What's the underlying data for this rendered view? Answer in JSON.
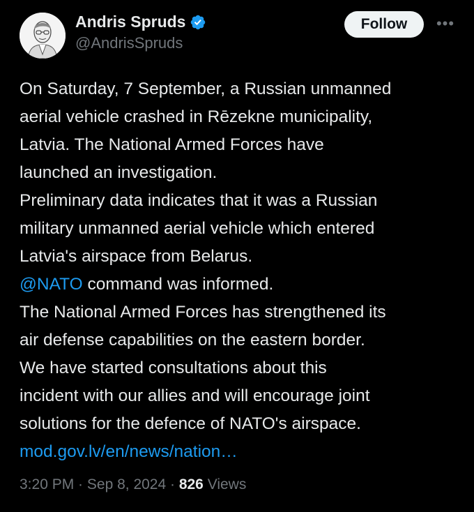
{
  "author": {
    "display_name": "Andris Spruds",
    "handle": "@AndrisSpruds",
    "verified": true,
    "avatar_icon": "person-portrait-avatar"
  },
  "actions": {
    "follow_label": "Follow",
    "more_icon": "more-horizontal-icon"
  },
  "tweet": {
    "lines": [
      {
        "text": "On Saturday, 7 September, a Russian unmanned"
      },
      {
        "text": "aerial vehicle crashed in Rēzekne municipality,"
      },
      {
        "text": "Latvia. The National Armed Forces have"
      },
      {
        "text": "launched an investigation."
      },
      {
        "text": "Preliminary data indicates that it was a Russian"
      },
      {
        "text": "military unmanned aerial vehicle which entered"
      },
      {
        "text": "Latvia's airspace from Belarus."
      },
      {
        "mention": "@NATO",
        "text": " command was informed."
      },
      {
        "text": "The National Armed Forces has strengthened its"
      },
      {
        "text": "air defense capabilities on the eastern border."
      },
      {
        "text": "We have  started consultations about this"
      },
      {
        "text": "incident with our allies and will encourage joint"
      },
      {
        "text": "solutions for the defence of NATO's airspace."
      },
      {
        "link": "mod.gov.lv/en/news/nation…"
      }
    ]
  },
  "meta": {
    "time": "3:20 PM",
    "separator": " · ",
    "date": "Sep 8, 2024",
    "views_count": "826",
    "views_label": " Views"
  },
  "colors": {
    "background": "#000000",
    "text": "#e7e9ea",
    "secondary": "#71767b",
    "accent": "#1d9bf0"
  }
}
